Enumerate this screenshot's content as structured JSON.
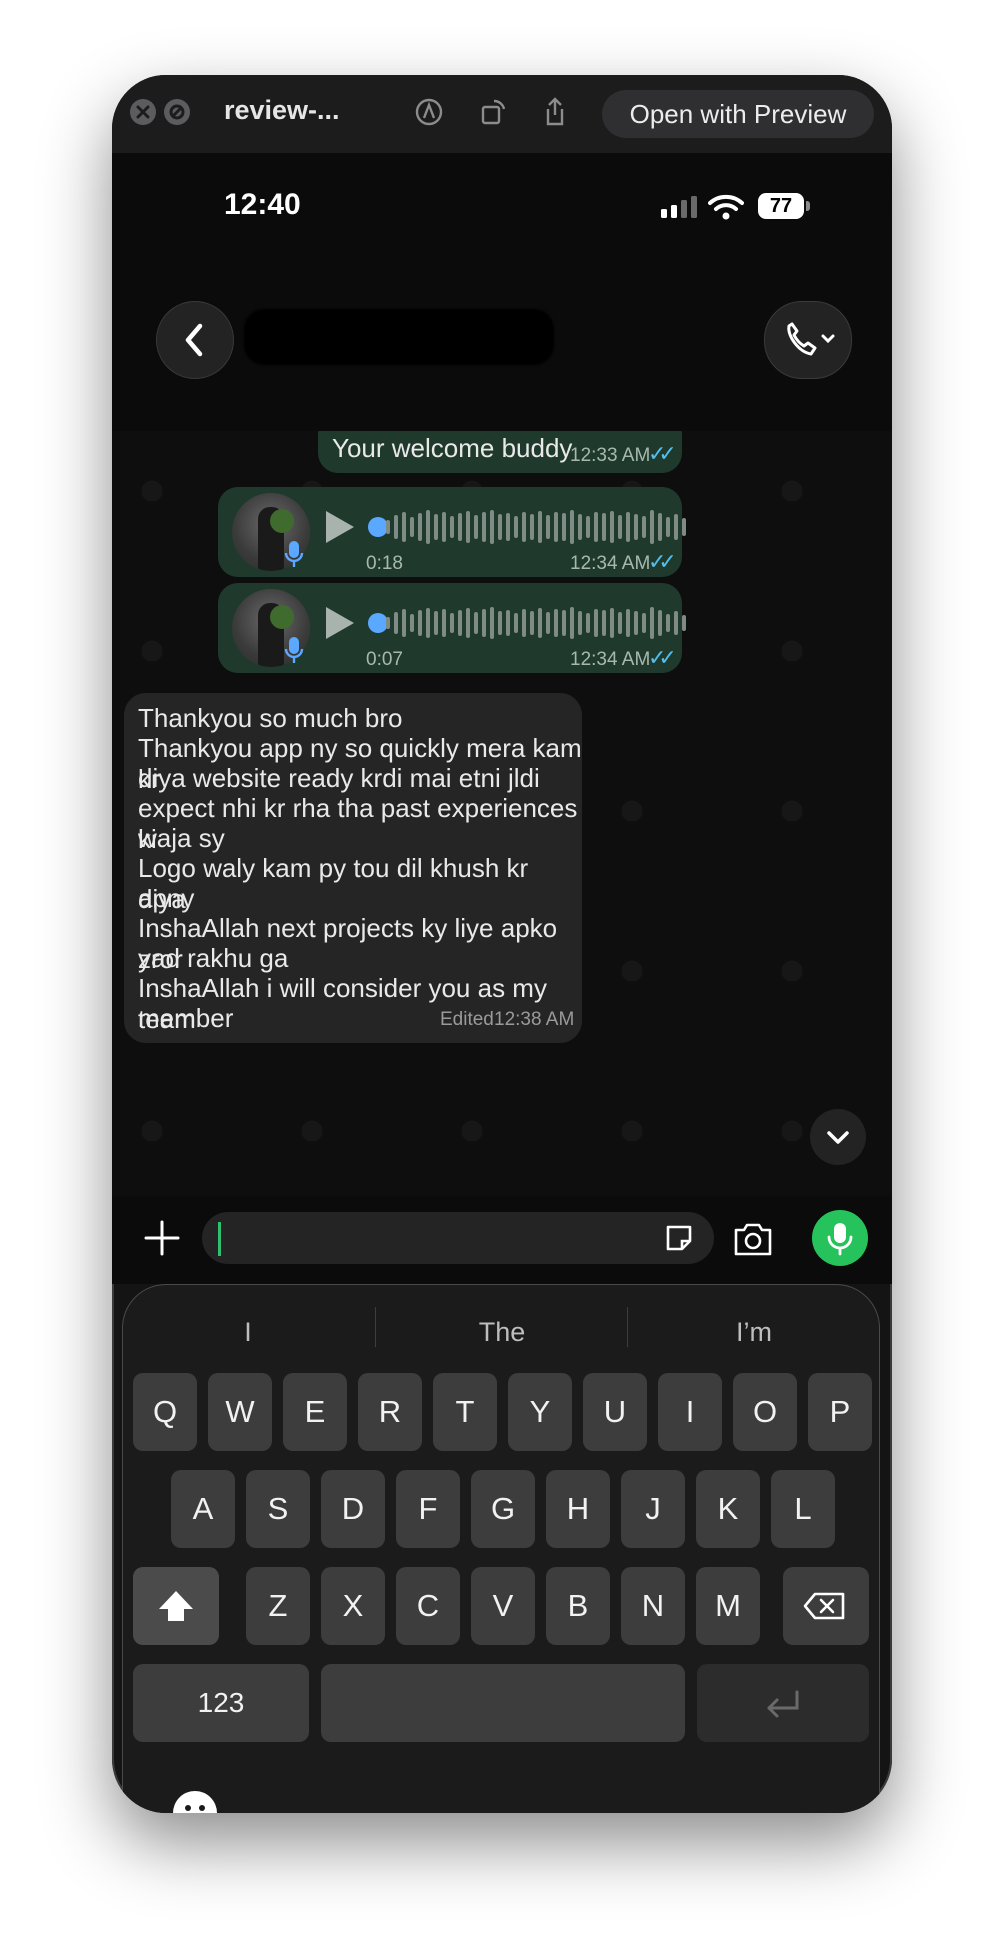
{
  "titlebar": {
    "title": "review-...",
    "open_button": "Open with Preview"
  },
  "status": {
    "time": "12:40",
    "battery": "77"
  },
  "messages": {
    "welcome_text": "Your welcome buddy",
    "welcome_time": "12:33 AM",
    "voice1_duration": "0:18",
    "voice1_time": "12:34 AM",
    "voice2_duration": "0:07",
    "voice2_time": "12:34 AM",
    "incoming_lines": [
      "Thankyou so much bro",
      "Thankyou app ny so quickly mera kam kr",
      "diya website ready krdi mai etni jldi",
      "expect nhi kr rha tha past experiences ki",
      "waja sy",
      "Logo waly kam py tou dil khush kr diya",
      "apny",
      "InshaAllah next projects ky liye apko zror",
      "yad rakhu ga",
      "InshaAllah i will consider you as my team",
      "member"
    ],
    "incoming_edited": "Edited",
    "incoming_time": "12:38 AM"
  },
  "keyboard": {
    "suggestions": [
      "I",
      "The",
      "I’m"
    ],
    "row1": [
      "Q",
      "W",
      "E",
      "R",
      "T",
      "Y",
      "U",
      "I",
      "O",
      "P"
    ],
    "row2": [
      "A",
      "S",
      "D",
      "F",
      "G",
      "H",
      "J",
      "K",
      "L"
    ],
    "row3": [
      "Z",
      "X",
      "C",
      "V",
      "B",
      "N",
      "M"
    ],
    "numbers_key": "123"
  },
  "colors": {
    "outgoing_bubble": "#1f3a2c",
    "incoming_bubble": "#252525",
    "accent_green": "#26c25c",
    "read_ticks": "#53bdeb"
  }
}
